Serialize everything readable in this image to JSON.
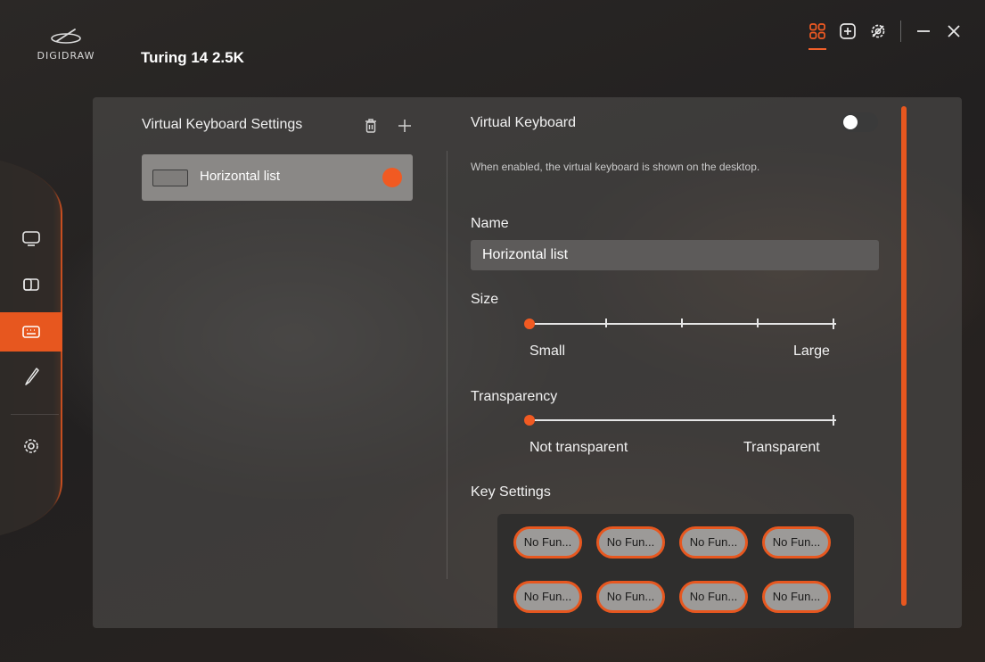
{
  "app": {
    "logo_text": "DIGIDRAW",
    "device_name": "Turing 14 2.5K",
    "accent_color": "#f15a22"
  },
  "titlebar": {
    "icons": [
      "grid-icon",
      "add-box-icon",
      "settings-gear-icon",
      "minimize-icon",
      "close-icon"
    ]
  },
  "sidebar": {
    "items": [
      {
        "name": "display-icon",
        "active": false
      },
      {
        "name": "multi-screen-icon",
        "active": false
      },
      {
        "name": "keyboard-icon",
        "active": true
      },
      {
        "name": "pen-icon",
        "active": false
      },
      {
        "name": "gear-icon",
        "active": false
      }
    ]
  },
  "left_panel": {
    "title": "Virtual Keyboard Settings",
    "keyboards": [
      {
        "label": "Horizontal list",
        "selected": true
      }
    ]
  },
  "right_panel": {
    "virtual_keyboard": {
      "title": "Virtual Keyboard",
      "enabled": false,
      "description": "When enabled, the virtual keyboard is shown on the desktop."
    },
    "name": {
      "label": "Name",
      "value": "Horizontal list"
    },
    "size": {
      "label": "Size",
      "min_label": "Small",
      "max_label": "Large",
      "value_fraction": 0.0,
      "steps": 5
    },
    "transparency": {
      "label": "Transparency",
      "min_label": "Not transparent",
      "max_label": "Transparent",
      "value_fraction": 0.0
    },
    "key_settings": {
      "label": "Key Settings",
      "keys": [
        "No Fun...",
        "No Fun...",
        "No Fun...",
        "No Fun...",
        "No Fun...",
        "No Fun...",
        "No Fun...",
        "No Fun..."
      ]
    }
  }
}
